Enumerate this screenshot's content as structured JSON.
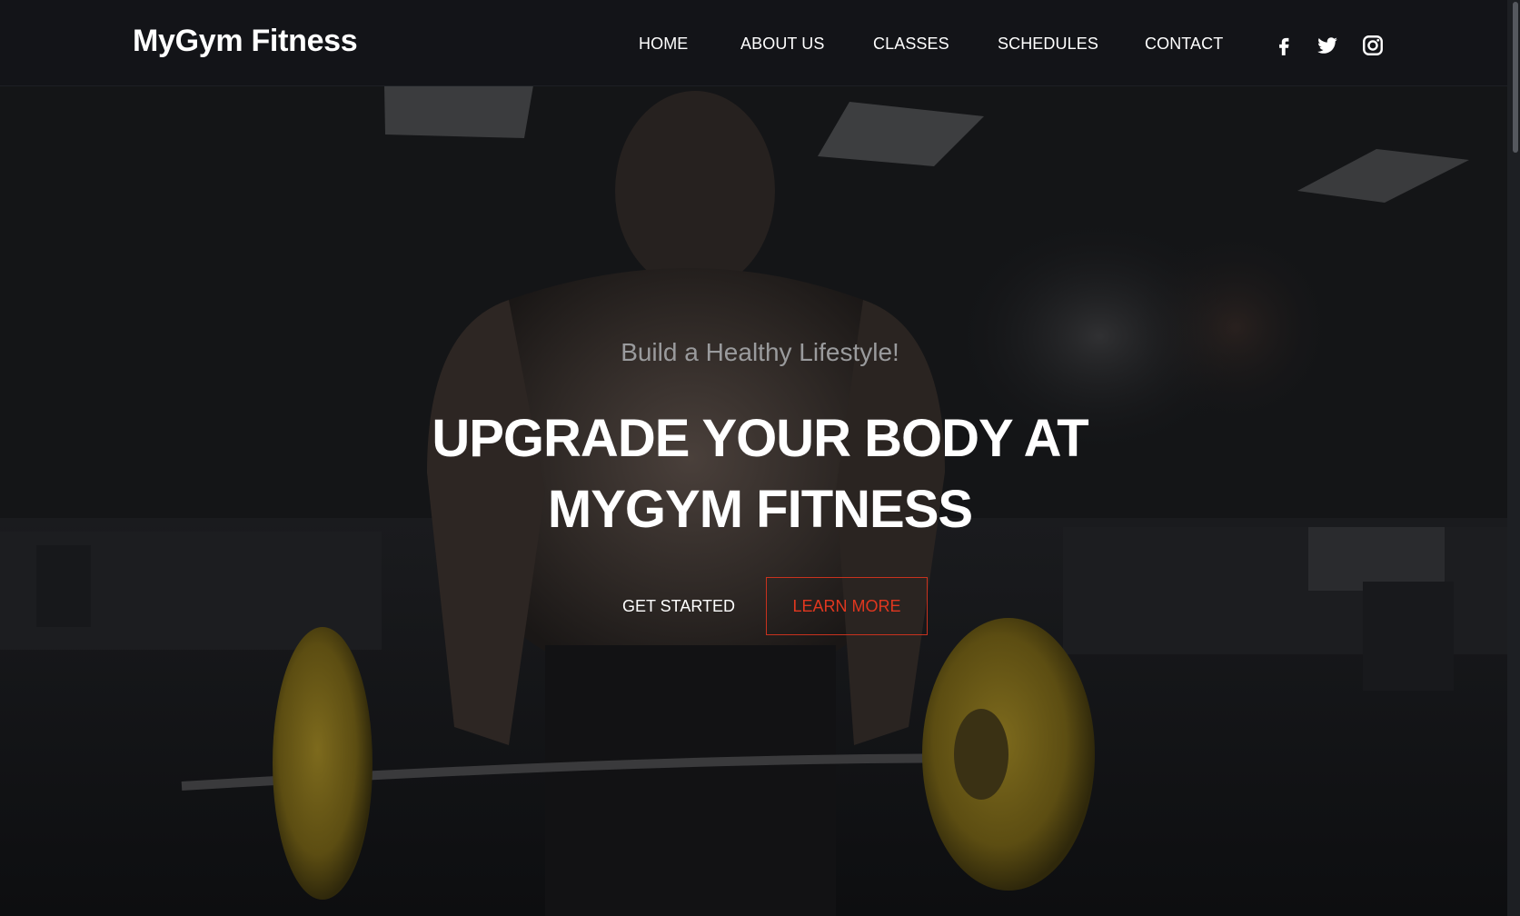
{
  "brand": {
    "name": "MyGym Fitness"
  },
  "nav": {
    "items": [
      {
        "label": "HOME"
      },
      {
        "label": "ABOUT US"
      },
      {
        "label": "CLASSES"
      },
      {
        "label": "SCHEDULES"
      },
      {
        "label": "CONTACT"
      }
    ]
  },
  "social": {
    "icons": [
      "facebook-icon",
      "twitter-icon",
      "instagram-icon"
    ]
  },
  "hero": {
    "subtitle": "Build a Healthy Lifestyle!",
    "title_line_1": "UPGRADE YOUR BODY AT",
    "title_line_2": "MYGYM FITNESS",
    "primary_button": "GET STARTED",
    "secondary_button": "LEARN MORE"
  },
  "colors": {
    "background": "#121316",
    "accent": "#e0371f",
    "text": "#ffffff",
    "subtitle": "#9a9b9d",
    "plates": "#7a6418"
  }
}
